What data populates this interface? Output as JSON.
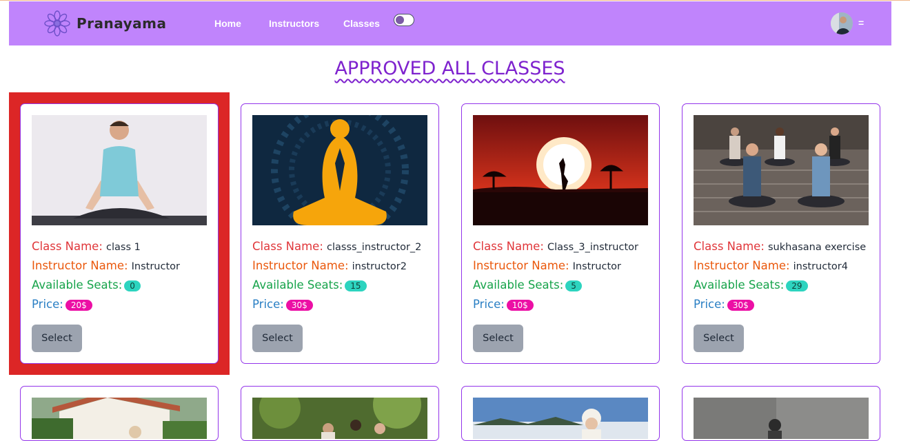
{
  "nav": {
    "brand": "Pranayama",
    "links": [
      "Home",
      "Instructors",
      "Classes"
    ],
    "menu_icon": "=",
    "accent": "#c084fc"
  },
  "page": {
    "title": "APPROVED ALL CLASSES"
  },
  "labels": {
    "class_name": "Class Name:",
    "instructor_name": "Instructor Name:",
    "available_seats": "Available Seats:",
    "price": "Price:",
    "select": "Select"
  },
  "classes": [
    {
      "class_name": "class 1",
      "instructor": "Instructor",
      "seats": "0",
      "price": "20$",
      "image": "man-meditating-photo",
      "selected": true
    },
    {
      "class_name": "classs_instructor_2",
      "instructor": "instructor2",
      "seats": "15",
      "price": "30$",
      "image": "meditation-silhouette-illustration"
    },
    {
      "class_name": "Class_3_instructor",
      "instructor": "Instructor",
      "seats": "5",
      "price": "10$",
      "image": "sunset-yoga-pose-photo"
    },
    {
      "class_name": "sukhasana exercise",
      "instructor": "instructor4",
      "seats": "29",
      "price": "30$",
      "image": "group-meditation-photo"
    }
  ],
  "more_cards": [
    "garden-house-photo",
    "outdoor-group-photo",
    "winter-outdoor-photo",
    "studio-yoga-photo"
  ]
}
